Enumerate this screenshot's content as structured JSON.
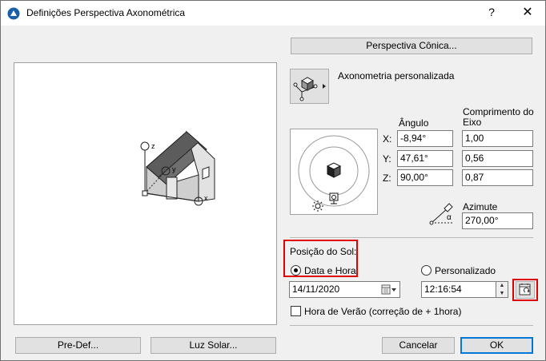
{
  "window": {
    "title": "Definições Perspectiva Axonométrica",
    "help_label": "?",
    "close_label": "✕"
  },
  "buttons": {
    "conic_perspective": "Perspectiva Cônica...",
    "predef": "Pre-Def...",
    "sunlight": "Luz Solar...",
    "cancel": "Cancelar",
    "ok": "OK"
  },
  "axonometry": {
    "mode_label": "Axonometria personalizada",
    "angle_header": "Ângulo",
    "axis_length_header": "Comprimento do Eixo",
    "rows": [
      {
        "axis": "X:",
        "angle": "-8,94°",
        "length": "1,00"
      },
      {
        "axis": "Y:",
        "angle": "47,61°",
        "length": "0,56"
      },
      {
        "axis": "Z:",
        "angle": "90,00°",
        "length": "0,87"
      }
    ],
    "azimuth_label": "Azimute",
    "azimuth_value": "270,00°",
    "azimuth_symbol": "α"
  },
  "preview": {
    "axis_labels": [
      "z",
      "y",
      "x"
    ]
  },
  "sun": {
    "section_label": "Posição do Sol:",
    "option_date_time": "Data e Hora",
    "option_custom": "Personalizado",
    "selected": "Data e Hora",
    "date_value": "14/11/2020",
    "time_value": "12:16:54",
    "dst_label": "Hora de Verão (correção de + 1hora)",
    "dst_checked": false
  },
  "icons": {
    "app": "archicad-icon",
    "axo_mode": "axonometry-cube-icon",
    "calendar": "calendar-icon",
    "calendar_sync": "calendar-sync-icon",
    "azimuth": "azimuth-icon",
    "sun": "sun-icon",
    "camera": "camera-icon"
  },
  "colors": {
    "highlight": "#e00000",
    "roof": "#6e6e6e",
    "wall": "#d0d0d0"
  }
}
